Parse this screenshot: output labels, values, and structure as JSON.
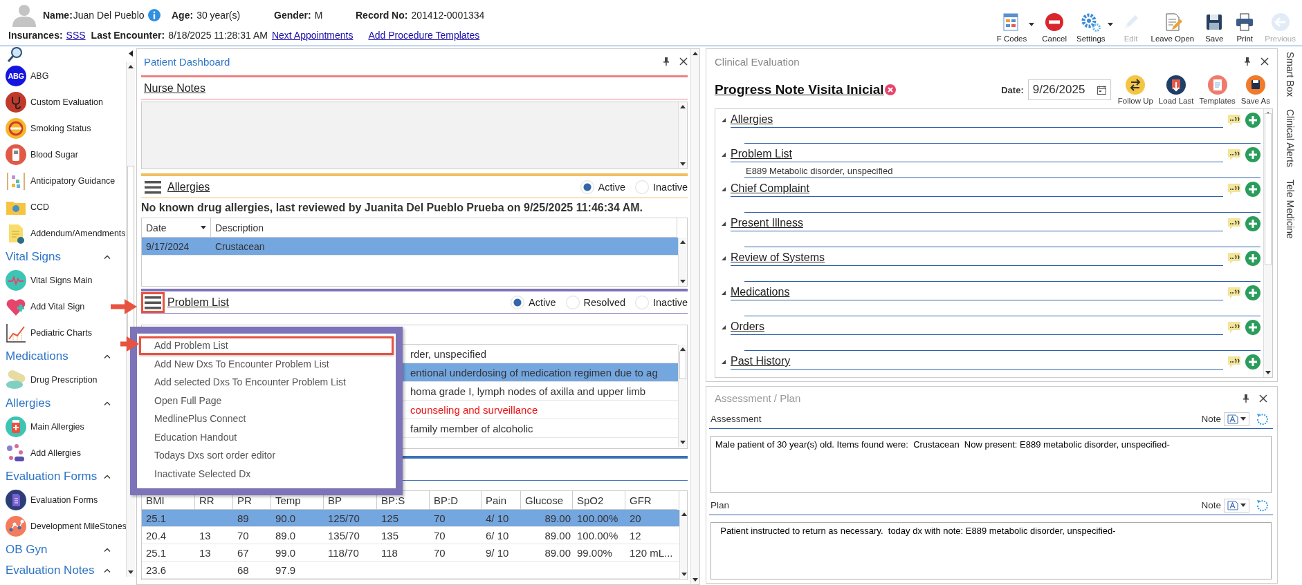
{
  "header": {
    "row1": [
      {
        "label": "Name:",
        "value": "Juan Del Pueblo",
        "info": true
      },
      {
        "label": "Age:",
        "value": "30 year(s)",
        "info": false
      },
      {
        "label": "Gender:",
        "value": "M",
        "info": false
      },
      {
        "label": "Record No:",
        "value": "201412-0001334",
        "info": false
      }
    ],
    "row2": [
      {
        "label": "Insurances:",
        "value": "SSS",
        "kind": "link"
      },
      {
        "label": "Last Encounter:",
        "value": "8/18/2025 11:28:31 AM",
        "kind": "text"
      }
    ],
    "links": [
      "Next Appointments",
      "Add Procedure Templates"
    ]
  },
  "toolbar": [
    {
      "label": "F Codes",
      "kind": "fcodes",
      "dropdown": true,
      "disabled": false
    },
    {
      "label": "Cancel",
      "kind": "cancel",
      "dropdown": false,
      "disabled": false
    },
    {
      "label": "Settings",
      "kind": "settings",
      "dropdown": true,
      "disabled": false
    },
    {
      "label": "Edit",
      "kind": "edit",
      "dropdown": false,
      "disabled": true
    },
    {
      "label": "Leave Open",
      "kind": "leave_open",
      "dropdown": false,
      "disabled": false
    },
    {
      "label": "Save",
      "kind": "save",
      "dropdown": false,
      "disabled": false
    },
    {
      "label": "Print",
      "kind": "print",
      "dropdown": false,
      "disabled": false
    },
    {
      "label": "Previous",
      "kind": "previous",
      "dropdown": false,
      "disabled": true
    }
  ],
  "sidebar": {
    "items": [
      {
        "kind": "item",
        "label": "ABG",
        "icon_text": "ABG"
      },
      {
        "kind": "item",
        "label": "Custom Evaluation"
      },
      {
        "kind": "item",
        "label": "Smoking Status"
      },
      {
        "kind": "item",
        "label": "Blood Sugar"
      },
      {
        "kind": "item",
        "label": "Anticipatory Guidance"
      },
      {
        "kind": "item",
        "label": "CCD"
      },
      {
        "kind": "item",
        "label": "Addendum/Amendments"
      },
      {
        "kind": "header",
        "label": "Vital Signs",
        "expanded": true
      },
      {
        "kind": "item",
        "label": "Vital Signs Main"
      },
      {
        "kind": "item",
        "label": "Add Vital Sign"
      },
      {
        "kind": "item",
        "label": "Pediatric Charts"
      },
      {
        "kind": "header",
        "label": "Medications",
        "expanded": true
      },
      {
        "kind": "item",
        "label": "Drug Prescription"
      },
      {
        "kind": "header",
        "label": "Allergies",
        "expanded": true
      },
      {
        "kind": "item",
        "label": "Main Allergies"
      },
      {
        "kind": "item",
        "label": "Add Allergies"
      },
      {
        "kind": "header",
        "label": "Evaluation Forms",
        "expanded": true
      },
      {
        "kind": "item",
        "label": "Evaluation Forms"
      },
      {
        "kind": "item",
        "label": "Development MileStones"
      },
      {
        "kind": "header",
        "label": "OB Gyn",
        "expanded": true
      },
      {
        "kind": "header",
        "label": "Evaluation Notes",
        "expanded": true
      }
    ]
  },
  "dashboard": {
    "title": "Patient Dashboard",
    "nurse_notes": {
      "title": "Nurse Notes"
    },
    "allergies": {
      "title": "Allergies",
      "menu_highlighted": false,
      "filters": [
        {
          "label": "Active",
          "selected": true
        },
        {
          "label": "Inactive",
          "selected": false
        }
      ],
      "summary": "No known drug allergies, last reviewed by Juanita Del Pueblo Prueba on 9/25/2025 11:46:34 AM.",
      "columns": [
        "Date",
        "Description"
      ],
      "rows": [
        {
          "cells": [
            "9/17/2024",
            "Crustacean"
          ],
          "selected": true
        }
      ]
    },
    "problem_list": {
      "title": "Problem List",
      "menu_highlighted": true,
      "filters": [
        {
          "label": "Active",
          "selected": true
        },
        {
          "label": "Resolved",
          "selected": false
        },
        {
          "label": "Inactive",
          "selected": false
        }
      ],
      "rows": [
        {
          "text": "rder, unspecified",
          "selected": false,
          "alert": false
        },
        {
          "text": "entional underdosing of medication regimen due to ag",
          "selected": true,
          "alert": false
        },
        {
          "text": "homa grade I, lymph nodes of axilla and upper limb",
          "selected": false,
          "alert": false
        },
        {
          "text": "counseling and surveillance",
          "selected": false,
          "alert": true
        },
        {
          "text": "family member of alcoholic",
          "selected": false,
          "alert": false
        }
      ]
    },
    "vitals": {
      "columns": [
        "BMI",
        "RR",
        "PR",
        "Temp",
        "BP",
        "BP:S",
        "BP:D",
        "Pain",
        "Glucose",
        "SpO2",
        "GFR"
      ],
      "rows": [
        {
          "cells": [
            "25.1",
            "",
            "89",
            "90.0",
            "125/70",
            "125",
            "70",
            "4/ 10",
            "89.00",
            "100.00%",
            "20"
          ],
          "selected": true
        },
        {
          "cells": [
            "20.4",
            "13",
            "70",
            "89.0",
            "135/70",
            "135",
            "70",
            "6/ 10",
            "89.00",
            "100.00%",
            "12"
          ],
          "selected": false
        },
        {
          "cells": [
            "25.1",
            "13",
            "67",
            "99.0",
            "118/70",
            "118",
            "70",
            "9/ 10",
            "89.00",
            "99.00%",
            "120 mL..."
          ],
          "selected": false
        },
        {
          "cells": [
            "23.6",
            "",
            "68",
            "97.9",
            "",
            "",
            "",
            "",
            "",
            "",
            ""
          ],
          "selected": false
        }
      ]
    },
    "menu": {
      "items": [
        {
          "label": "Add Problem List",
          "highlighted": true
        },
        {
          "label": "Add New Dxs To Encounter Problem List",
          "highlighted": false
        },
        {
          "label": "Add selected Dxs To Encounter Problem List",
          "highlighted": false
        },
        {
          "label": "Open Full Page",
          "highlighted": false
        },
        {
          "label": "MedlinePlus Connect",
          "highlighted": false
        },
        {
          "label": "Education Handout",
          "highlighted": false
        },
        {
          "label": "Todays Dxs sort order editor",
          "highlighted": false
        },
        {
          "label": "Inactivate Selected Dx",
          "highlighted": false
        }
      ]
    }
  },
  "clinical_evaluation": {
    "title": "Clinical Evaluation",
    "note_title": "Progress Note Visita Inicial",
    "date_label": "Date:",
    "date": "9/26/2025",
    "actions": [
      {
        "label": "Follow Up",
        "kind": "follow_up"
      },
      {
        "label": "Load Last",
        "kind": "load_last"
      },
      {
        "label": "Templates",
        "kind": "templates"
      },
      {
        "label": "Save As",
        "kind": "save_as"
      }
    ],
    "sections": [
      {
        "title": "Allergies",
        "expanded": true
      },
      {
        "title": "Problem List",
        "expanded": true,
        "content": "E889 Metabolic disorder, unspecified"
      },
      {
        "title": "Chief Complaint",
        "expanded": true
      },
      {
        "title": "Present Illness",
        "expanded": true
      },
      {
        "title": "Review of Systems",
        "expanded": true
      },
      {
        "title": "Medications",
        "expanded": true
      },
      {
        "title": "Orders",
        "expanded": true
      },
      {
        "title": "Past History",
        "expanded": true
      }
    ]
  },
  "assessment_plan": {
    "title": "Assessment / Plan",
    "fields": [
      {
        "label": "Assessment",
        "note_label": "Note",
        "text": "Male patient of 30 year(s) old. Items found were:  Crustacean  Now present: E889 metabolic disorder, unspecified-"
      },
      {
        "label": "Plan",
        "note_label": "Note",
        "text": "  Patient instructed to return as necessary.  today dx with note: E889 metabolic disorder, unspecified-"
      }
    ]
  },
  "side_tabs": [
    "Smart Box",
    "Clinical Alerts",
    "Tele Medicine"
  ]
}
